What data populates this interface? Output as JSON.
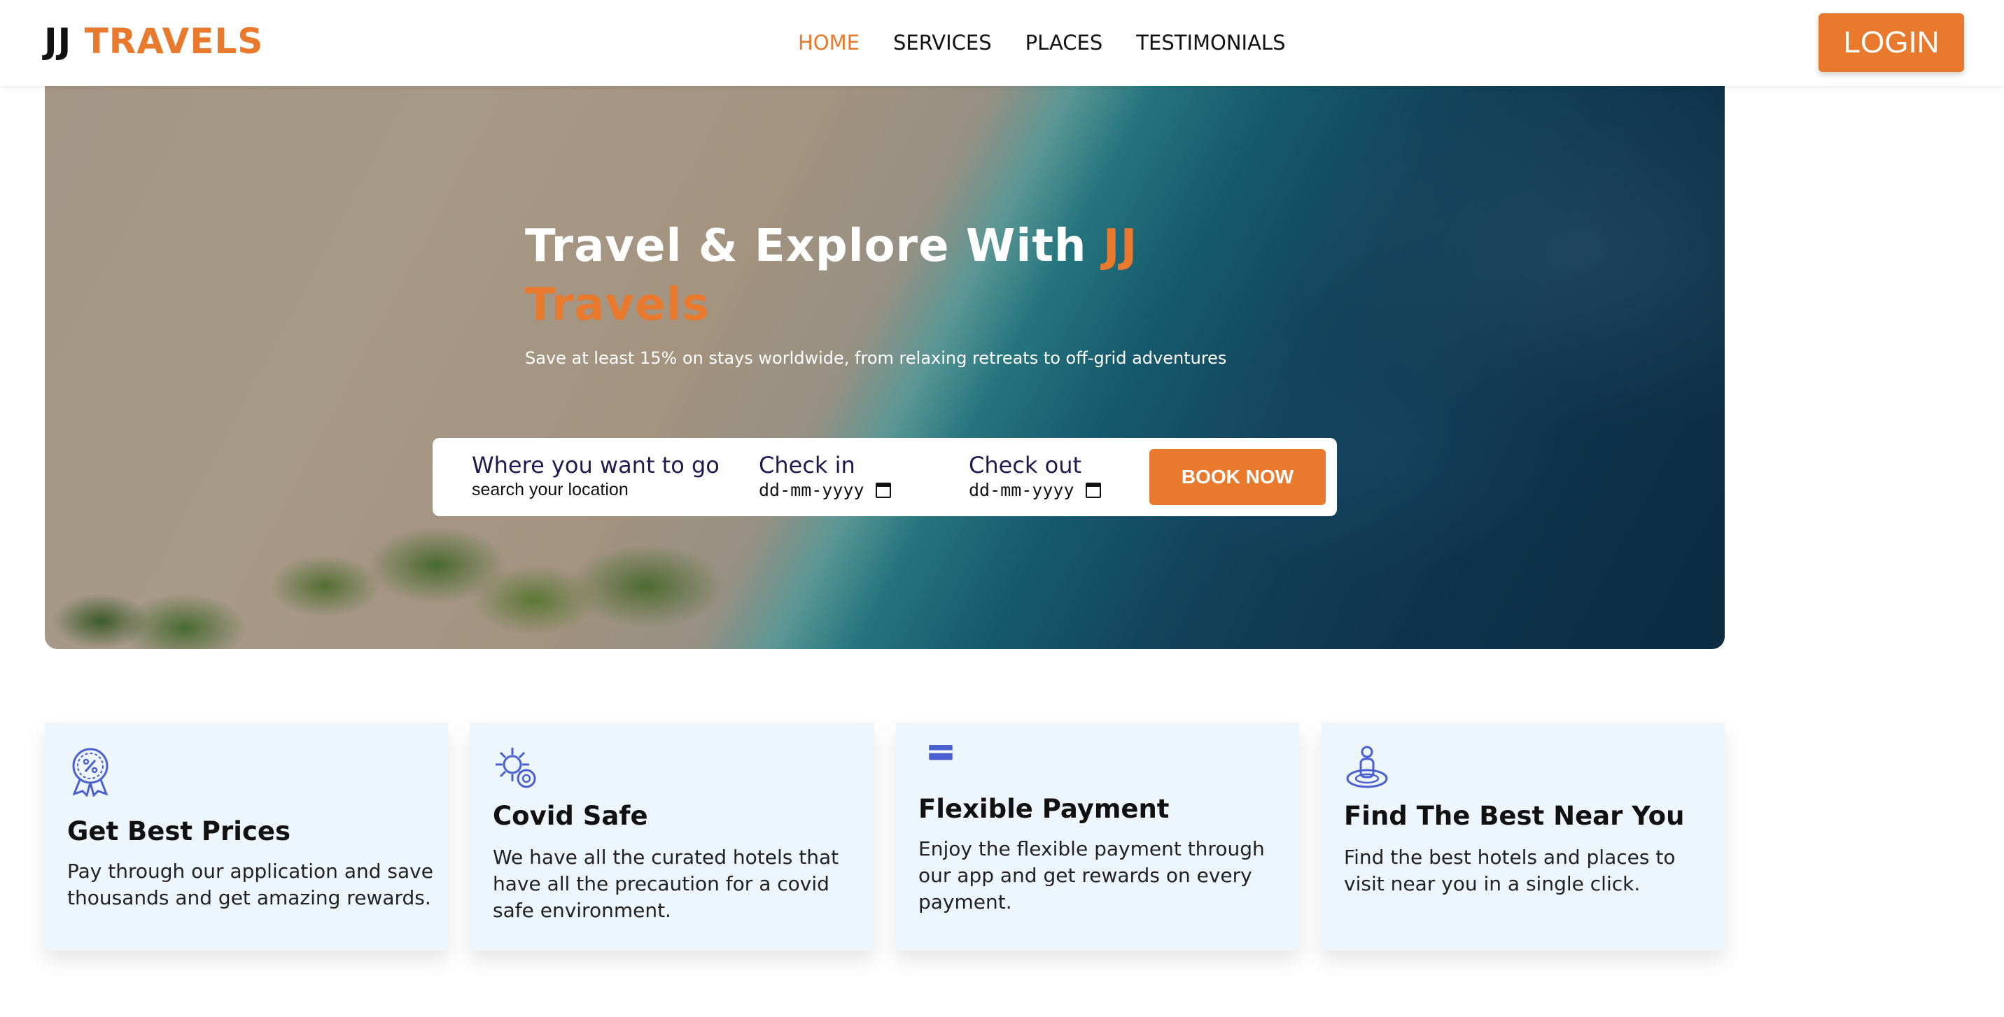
{
  "brand": {
    "part1": "JJ",
    "part2": "TRAVELS"
  },
  "nav": {
    "links": [
      "HOME",
      "SERVICES",
      "PLACES",
      "TESTIMONIALS"
    ],
    "active": "HOME",
    "login_label": "LOGIN"
  },
  "hero": {
    "title_prefix": "Travel & Explore With ",
    "title_highlight": "JJ Travels",
    "subtitle": "Save at least 15% on stays worldwide, from relaxing retreats to off-grid adventures"
  },
  "booking": {
    "destination_label": "Where you want to go",
    "destination_placeholder": "search your location",
    "checkin_label": "Check in",
    "checkin_placeholder": "dd-mm-yyyy",
    "checkout_label": "Check out",
    "checkout_placeholder": "dd-mm-yyyy",
    "book_label": "BOOK NOW"
  },
  "features": [
    {
      "icon": "discount-badge-icon",
      "title": "Get Best Prices",
      "text": "Pay through our application and save thousands and get amazing rewards."
    },
    {
      "icon": "virus-shield-icon",
      "title": "Covid Safe",
      "text": "We have all the curated hotels that have all the precaution for a covid safe environment."
    },
    {
      "icon": "credit-card-icon",
      "title": "Flexible Payment",
      "text": "Enjoy the flexible payment through our app and get rewards on every payment."
    },
    {
      "icon": "location-person-icon",
      "title": "Find The Best Near You",
      "text": "Find the best hotels and places to visit near you in a single click."
    }
  ],
  "colors": {
    "accent": "#e9792c",
    "card_bg": "#eef6fd",
    "icon": "#4a5fd0",
    "label": "#1f1a4e"
  }
}
